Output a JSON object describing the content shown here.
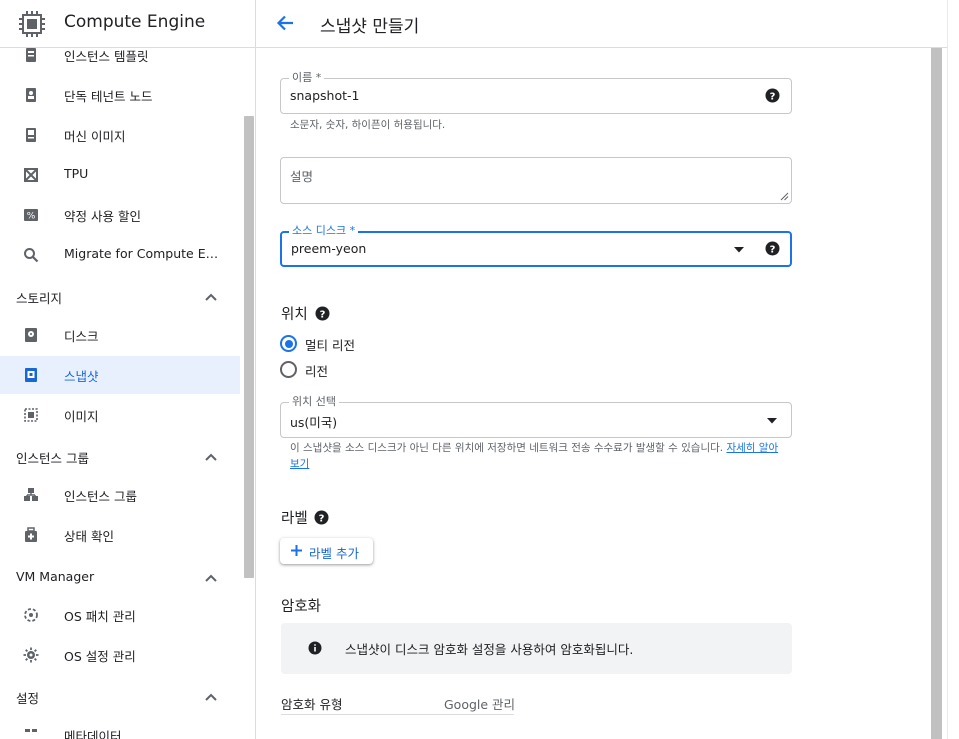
{
  "app": {
    "title": "Compute Engine",
    "logo_icon": "compute-engine-chip-icon"
  },
  "sidebar": {
    "items_top": [
      {
        "label": "인스턴스 템플릿",
        "icon": "instance-template-icon"
      },
      {
        "label": "단독 테넌트 노드",
        "icon": "sole-tenant-node-icon"
      },
      {
        "label": "머신 이미지",
        "icon": "machine-image-icon"
      },
      {
        "label": "TPU",
        "icon": "tpu-icon"
      },
      {
        "label": "약정 사용 할인",
        "icon": "percent-icon"
      },
      {
        "label": "Migrate for Compute Engi...",
        "icon": "search-icon"
      }
    ],
    "storage": {
      "title": "스토리지",
      "items": [
        {
          "label": "디스크",
          "icon": "disk-icon"
        },
        {
          "label": "스냅샷",
          "icon": "snapshot-icon",
          "active": true
        },
        {
          "label": "이미지",
          "icon": "image-icon"
        }
      ]
    },
    "instance_groups": {
      "title": "인스턴스 그룹",
      "items": [
        {
          "label": "인스턴스 그룹",
          "icon": "instance-group-icon"
        },
        {
          "label": "상태 확인",
          "icon": "health-check-icon"
        }
      ]
    },
    "vm_manager": {
      "title": "VM Manager",
      "items": [
        {
          "label": "OS 패치 관리",
          "icon": "os-patch-icon"
        },
        {
          "label": "OS 설정 관리",
          "icon": "os-config-icon"
        }
      ]
    },
    "settings": {
      "title": "설정",
      "partial_item": "메타데이터"
    }
  },
  "header": {
    "title": "스냅샷 만들기",
    "back_icon": "arrow-back-icon"
  },
  "form": {
    "name": {
      "label": "이름 *",
      "value": "snapshot-1",
      "hint": "소문자, 숫자, 하이픈이 허용됩니다."
    },
    "description": {
      "placeholder": "설명"
    },
    "source_disk": {
      "label": "소스 디스크 *",
      "value": "preem-yeon"
    },
    "location": {
      "title": "위치",
      "options": [
        {
          "label": "멀티 리전",
          "checked": true
        },
        {
          "label": "리전",
          "checked": false
        }
      ],
      "select": {
        "label": "위치 선택",
        "value": "us(미국)"
      },
      "hint": "이 스냅샷을 소스 디스크가 아닌 다른 위치에 저장하면 네트워크 전송 수수료가 발생할 수 있습니다.",
      "hint_link": "자세히 알아보기"
    },
    "labels": {
      "title": "라벨",
      "add_button": "라벨 추가"
    },
    "encryption": {
      "title": "암호화",
      "info": "스냅샷이 디스크 암호화 설정을 사용하여 암호화됩니다.",
      "type_label": "암호화 유형",
      "type_value": "Google 관리"
    }
  },
  "colors": {
    "accent": "#1a73e8",
    "active_bg": "#e8f0fe",
    "active_text": "#1967d2",
    "info_bg": "#f1f3f4"
  }
}
